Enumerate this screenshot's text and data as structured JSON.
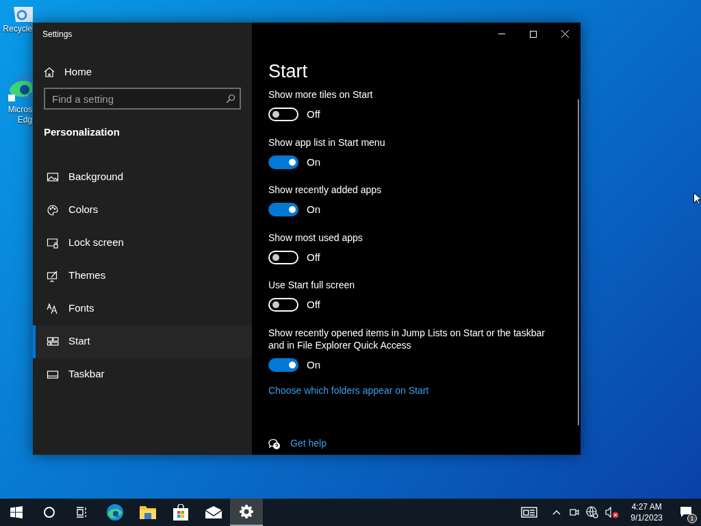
{
  "desktop_icons": [
    {
      "kind": "recycle",
      "label_lines": [
        "Recycle"
      ]
    },
    {
      "kind": "edge",
      "label_lines": [
        "Micros",
        "Edg"
      ]
    }
  ],
  "window": {
    "title": "Settings"
  },
  "sidebar": {
    "home": "Home",
    "search": {
      "placeholder": "Find a setting"
    },
    "section": "Personalization",
    "items": [
      {
        "kind": "background",
        "label": "Background",
        "selected": false
      },
      {
        "kind": "colors",
        "label": "Colors",
        "selected": false
      },
      {
        "kind": "lock",
        "label": "Lock screen",
        "selected": false
      },
      {
        "kind": "themes",
        "label": "Themes",
        "selected": false
      },
      {
        "kind": "fonts",
        "label": "Fonts",
        "selected": false
      },
      {
        "kind": "start",
        "label": "Start",
        "selected": true
      },
      {
        "kind": "taskbar",
        "label": "Taskbar",
        "selected": false
      }
    ]
  },
  "content": {
    "heading": "Start",
    "settings": [
      {
        "label": "Show more tiles on Start",
        "on": false,
        "state_text": "Off"
      },
      {
        "label": "Show app list in Start menu",
        "on": true,
        "state_text": "On"
      },
      {
        "label": "Show recently added apps",
        "on": true,
        "state_text": "On"
      },
      {
        "label": "Show most used apps",
        "on": false,
        "state_text": "Off"
      },
      {
        "label": "Use Start full screen",
        "on": false,
        "state_text": "Off"
      },
      {
        "label": "Show recently opened items in Jump Lists on Start or the taskbar and in File Explorer Quick Access",
        "on": true,
        "state_text": "On"
      }
    ],
    "link": "Choose which folders appear on Start",
    "help_link": "Get help"
  },
  "taskbar": {
    "apps": [
      {
        "kind": "start",
        "selected": false
      },
      {
        "kind": "search",
        "selected": false
      },
      {
        "kind": "taskview",
        "selected": false
      },
      {
        "kind": "edge",
        "selected": false
      },
      {
        "kind": "explorer",
        "selected": false
      },
      {
        "kind": "store",
        "selected": false
      },
      {
        "kind": "mail",
        "selected": false
      },
      {
        "kind": "settings",
        "selected": true
      }
    ],
    "time": "4:27 AM",
    "date": "9/1/2023",
    "notification_count": "1"
  }
}
